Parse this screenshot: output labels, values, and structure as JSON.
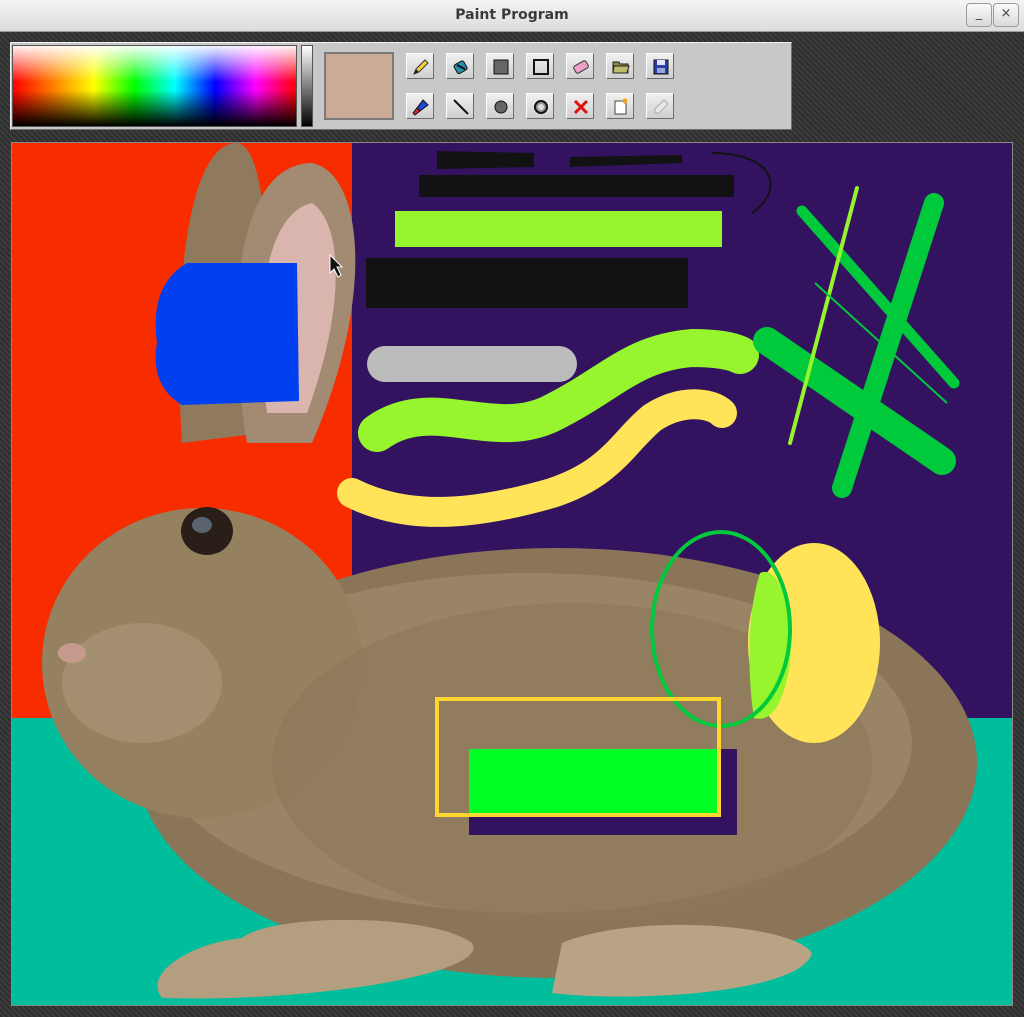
{
  "window": {
    "title": "Paint Program",
    "minimize_label": "_",
    "close_label": "×"
  },
  "toolbar": {
    "current_color": "#ccab96",
    "tools": [
      {
        "name": "pencil-tool",
        "icon": "pencil-icon"
      },
      {
        "name": "fill-tool",
        "icon": "paint-bucket-icon"
      },
      {
        "name": "filled-rectangle-tool",
        "icon": "filled-square-icon"
      },
      {
        "name": "rectangle-tool",
        "icon": "square-outline-icon"
      },
      {
        "name": "eraser-tool",
        "icon": "eraser-icon"
      },
      {
        "name": "open-tool",
        "icon": "folder-icon"
      },
      {
        "name": "save-tool",
        "icon": "floppy-disk-icon"
      },
      {
        "name": "brush-tool",
        "icon": "brush-icon"
      },
      {
        "name": "line-tool",
        "icon": "line-icon"
      },
      {
        "name": "filled-ellipse-tool",
        "icon": "filled-circle-icon"
      },
      {
        "name": "ellipse-tool",
        "icon": "circle-outline-icon"
      },
      {
        "name": "clear-tool",
        "icon": "red-x-icon"
      },
      {
        "name": "new-tool",
        "icon": "new-document-icon"
      },
      {
        "name": "color-picker-tool",
        "icon": "eyedropper-icon"
      }
    ]
  },
  "canvas": {
    "background_regions": [
      "red-orange",
      "dark-purple",
      "teal"
    ],
    "colors": {
      "red": "#f72d00",
      "purple": "#33135f",
      "teal": "#00be9b",
      "blue": "#0040f0",
      "black": "#121212",
      "lime": "#96f52d",
      "light-gray": "#bcbcbc",
      "yellow": "#ffe359",
      "green": "#00c93c",
      "bright-green": "#00ff22",
      "gold": "#ffd52e"
    }
  }
}
